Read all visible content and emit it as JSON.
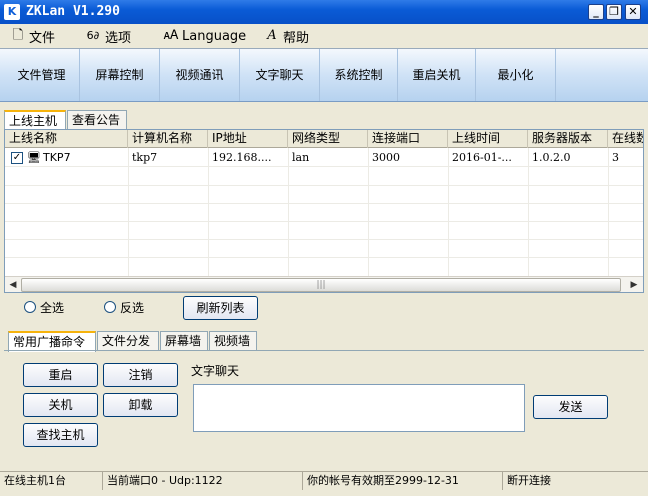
{
  "window": {
    "title": "ZKLan V1.290",
    "icon_letter": "K"
  },
  "menu": [
    {
      "label": "文件",
      "icon": "document-icon",
      "glyph": "🗋"
    },
    {
      "label": "选项",
      "icon": "glasses-icon",
      "glyph": "6∂"
    },
    {
      "label": "Language",
      "icon": "language-icon",
      "glyph": "🗚"
    },
    {
      "label": "帮助",
      "icon": "help-icon",
      "glyph": "A"
    }
  ],
  "toolbar": [
    "文件管理",
    "屏幕控制",
    "视频通讯",
    "文字聊天",
    "系统控制",
    "重启关机",
    "最小化"
  ],
  "top_tabs": [
    "上线主机",
    "查看公告"
  ],
  "table": {
    "columns": [
      "上线名称",
      "计算机名称",
      "IP地址",
      "网络类型",
      "连接端口",
      "上线时间",
      "服务器版本",
      "在线数"
    ],
    "rows": [
      [
        "TKP7",
        "tkp7",
        "192.168....",
        "lan",
        "3000",
        "2016-01-...",
        "1.0.2.0",
        "3"
      ]
    ]
  },
  "select": {
    "all": "全选",
    "invert": "反选",
    "refresh": "刷新列表"
  },
  "bottom_tabs": [
    "常用广播命令",
    "文件分发",
    "屏幕墙",
    "视频墙"
  ],
  "commands": {
    "restart": "重启",
    "logout": "注销",
    "shutdown": "关机",
    "uninstall": "卸载",
    "find": "查找主机"
  },
  "chat": {
    "label": "文字聊天",
    "send": "发送"
  },
  "status": [
    "在线主机1台",
    "当前端口0 - Udp:1122",
    "你的帐号有效期至2999-12-31",
    "断开连接"
  ]
}
